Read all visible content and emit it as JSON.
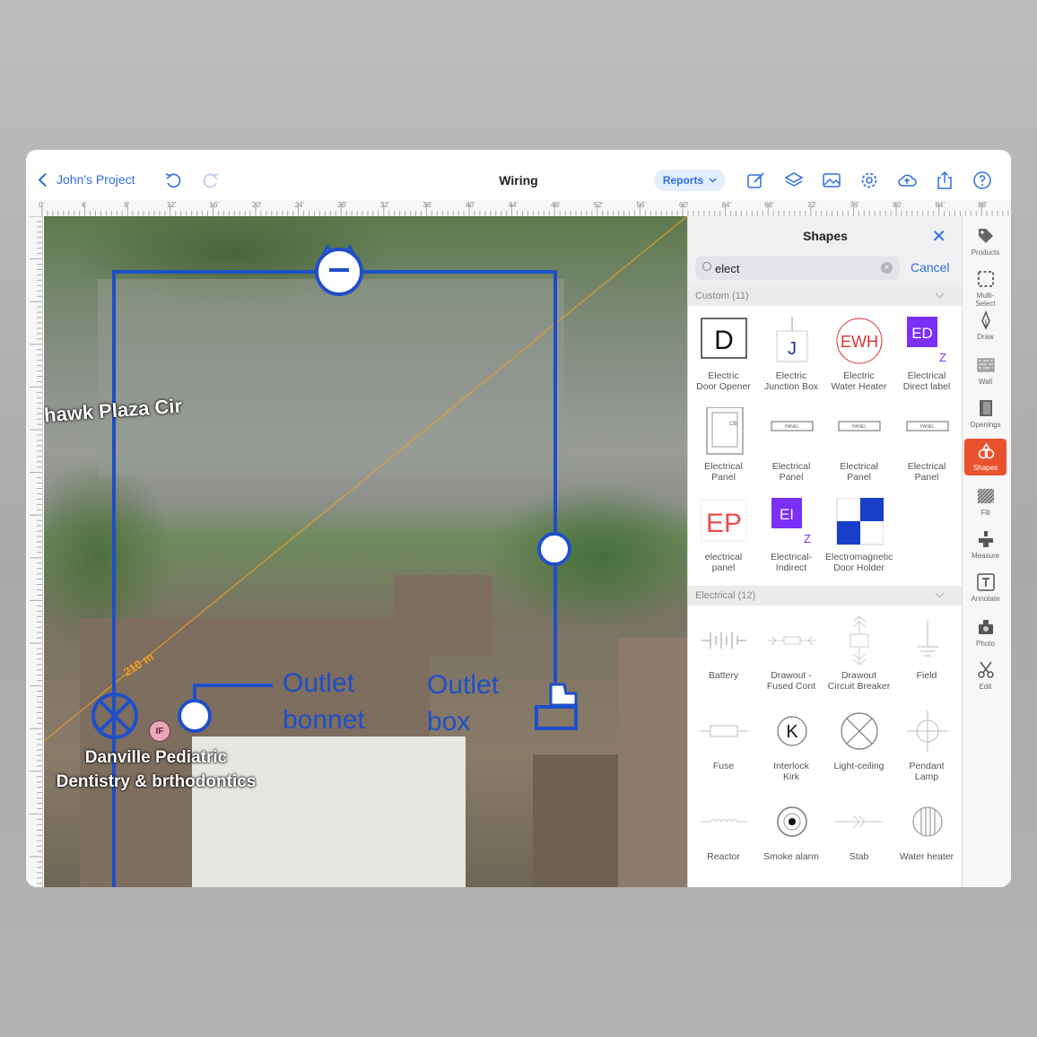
{
  "topbar": {
    "back_label": "John's Project",
    "title": "Wiring",
    "reports_label": "Reports",
    "icons": [
      "undo-icon",
      "redo-icon",
      "edit-icon",
      "layers-icon",
      "image-icon",
      "gear-icon",
      "cloud-upload-icon",
      "share-icon",
      "help-icon"
    ]
  },
  "ruler": {
    "top_ticks": [
      "0'",
      "4'",
      "8'",
      "12'",
      "16'",
      "20'",
      "24'",
      "28'",
      "32'",
      "36'",
      "40'",
      "44'",
      "48'",
      "52'",
      "56'",
      "60'",
      "64'",
      "68'",
      "72'",
      "76'",
      "80'",
      "84'",
      "88'"
    ]
  },
  "map": {
    "street_label": "hawk Plaza Cir",
    "poi_line1": "Danville Pediatric",
    "poi_line2": "Dentistry & brthodontics",
    "poi_badge": "IF",
    "dimension_label": "210 m",
    "label_outlet_bonnet_1": "Outlet",
    "label_outlet_bonnet_2": "bonnet",
    "label_outlet_box_1": "Outlet",
    "label_outlet_box_2": "box",
    "wire_color": "#1e4fc9",
    "dimension_color": "#f0a020"
  },
  "panel": {
    "title": "Shapes",
    "search_value": "elect",
    "cancel_label": "Cancel",
    "custom_section": "Custom (11)",
    "electrical_section": "Electrical (12)",
    "custom_items": [
      {
        "label1": "Electric",
        "label2": "Door Opener",
        "glyph": "D"
      },
      {
        "label1": "Electric",
        "label2": "Junction Box",
        "glyph": "J"
      },
      {
        "label1": "Electric",
        "label2": "Water Heater",
        "glyph": "EWH"
      },
      {
        "label1": "Electrical",
        "label2": "Direct label",
        "glyph": "ED"
      },
      {
        "label1": "Electrical",
        "label2": "Panel",
        "glyph": "CB"
      },
      {
        "label1": "Electrical",
        "label2": "Panel",
        "glyph": "PANEL"
      },
      {
        "label1": "Electrical",
        "label2": "Panel",
        "glyph": "PANEL"
      },
      {
        "label1": "Electrical",
        "label2": "Panel",
        "glyph": "PANEL"
      },
      {
        "label1": "electrical",
        "label2": "panel",
        "glyph": "EP"
      },
      {
        "label1": "Electrical-",
        "label2": "Indirect",
        "glyph": "EI"
      },
      {
        "label1": "Electromagnetic",
        "label2": "Door Holder",
        "glyph": ""
      }
    ],
    "electrical_items": [
      {
        "label1": "Battery",
        "label2": ""
      },
      {
        "label1": "Drawout -",
        "label2": "Fused Cont"
      },
      {
        "label1": "Drawout",
        "label2": "Circuit Breaker"
      },
      {
        "label1": "Field",
        "label2": ""
      },
      {
        "label1": "Fuse",
        "label2": ""
      },
      {
        "label1": "Interlock",
        "label2": "Kirk",
        "glyph": "K"
      },
      {
        "label1": "Light-ceiling",
        "label2": ""
      },
      {
        "label1": "Pendant",
        "label2": "Lamp"
      },
      {
        "label1": "Reactor",
        "label2": ""
      },
      {
        "label1": "Smoke alarm",
        "label2": ""
      },
      {
        "label1": "Stab",
        "label2": ""
      },
      {
        "label1": "Water heater",
        "label2": ""
      }
    ],
    "glyph_z": "Z"
  },
  "toolbar": {
    "items": [
      {
        "label": "Products",
        "icon": "tag-icon"
      },
      {
        "label": "Multi-",
        "label2": "Select",
        "icon": "multi-select-icon"
      },
      {
        "label": "Draw",
        "icon": "pen-icon"
      },
      {
        "label": "Wall",
        "icon": "wall-icon"
      },
      {
        "label": "Openings",
        "icon": "door-icon"
      },
      {
        "label": "Shapes",
        "icon": "shapes-icon"
      },
      {
        "label": "Fill",
        "icon": "fill-icon"
      },
      {
        "label": "Measure",
        "icon": "measure-icon"
      },
      {
        "label": "Annotate",
        "icon": "text-icon"
      },
      {
        "label": "Photo",
        "icon": "camera-icon"
      },
      {
        "label": "Edit",
        "icon": "scissors-icon"
      }
    ],
    "active_color": "#e8532e"
  }
}
